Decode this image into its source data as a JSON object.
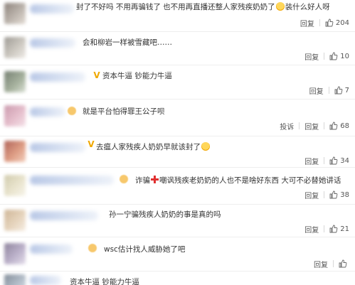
{
  "labels": {
    "reply": "回复",
    "report": "投诉"
  },
  "comments": [
    {
      "text_a": "封了不好吗 不用再骗钱了 也不用再直播还整人家残疾奶奶了",
      "text_b": "装什么好人呀",
      "likes": "204"
    },
    {
      "text": "会和柳岩一样被雪藏吧……",
      "likes": "10"
    },
    {
      "text": "资本牛逼 钞能力牛逼",
      "likes": "7"
    },
    {
      "text": "就是平台怕得罪王公子呗",
      "likes": "68"
    },
    {
      "text": "去瘟人家残疾人奶奶早就该封了",
      "likes": "34"
    },
    {
      "text_a": "诈骗",
      "text_b": "嘲讽残疾老奶奶的人也不是啥好东西 大可不必替她讲话",
      "likes": "38"
    },
    {
      "text": "孙一宁骗残疾人奶奶的事是真的吗",
      "likes": "21"
    },
    {
      "text": "wsc估计找人威胁她了吧",
      "likes": ""
    },
    {
      "text": "资本牛逼 钞能力牛逼",
      "likes": ""
    }
  ],
  "colors": {
    "text": "#333333",
    "action": "#555555",
    "name_blur": "#c9d6ee"
  },
  "icons": {
    "like": "thumbs-up-icon",
    "verified": "v-badge-icon",
    "smiley": "smiley-emoji-icon",
    "cross": "red-cross-emoji-icon"
  }
}
